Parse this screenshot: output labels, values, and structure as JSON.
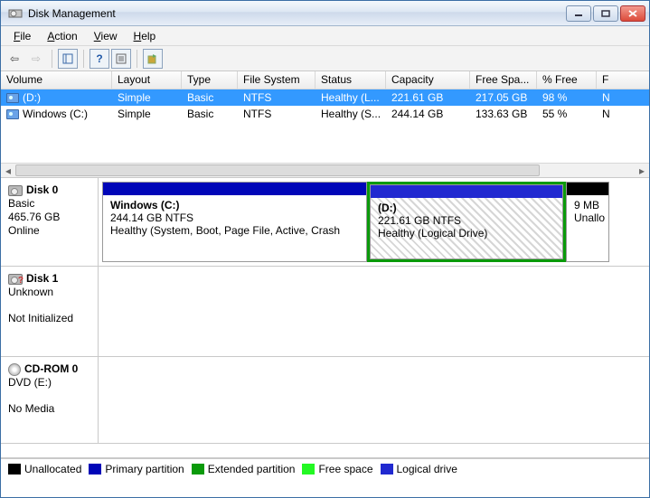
{
  "window": {
    "title": "Disk Management"
  },
  "menus": {
    "file": "File",
    "action": "Action",
    "view": "View",
    "help": "Help"
  },
  "columns": {
    "volume": "Volume",
    "layout": "Layout",
    "type": "Type",
    "filesystem": "File System",
    "status": "Status",
    "capacity": "Capacity",
    "freespace": "Free Spa...",
    "pctfree": "% Free",
    "f": "F"
  },
  "volumes": [
    {
      "name": "(D:)",
      "layout": "Simple",
      "type": "Basic",
      "fs": "NTFS",
      "status": "Healthy (L...",
      "capacity": "221.61 GB",
      "free": "217.05 GB",
      "pct": "98 %",
      "fa": "N",
      "selected": true
    },
    {
      "name": "Windows (C:)",
      "layout": "Simple",
      "type": "Basic",
      "fs": "NTFS",
      "status": "Healthy (S...",
      "capacity": "244.14 GB",
      "free": "133.63 GB",
      "pct": "55 %",
      "fa": "N",
      "selected": false
    }
  ],
  "disks": [
    {
      "id": "disk0",
      "name": "Disk 0",
      "type": "Basic",
      "size": "465.76 GB",
      "state": "Online",
      "iconKind": "hd",
      "partitions": [
        {
          "kind": "primary",
          "title": "Windows  (C:)",
          "line2": "244.14 GB NTFS",
          "line3": "Healthy (System, Boot, Page File, Active, Crash",
          "widthPx": 293,
          "hatched": false,
          "selected": false
        },
        {
          "kind": "extended",
          "children": [
            {
              "kind": "logical",
              "title": " (D:)",
              "line2": "221.61 GB NTFS",
              "line3": "Healthy (Logical Drive)",
              "widthPx": 214,
              "hatched": true,
              "selected": true
            }
          ]
        },
        {
          "kind": "unalloc",
          "title": "",
          "line2": "9 MB",
          "line3": "Unallo",
          "widthPx": 48,
          "hatched": false,
          "selected": false
        }
      ]
    },
    {
      "id": "disk1",
      "name": "Disk 1",
      "type": "Unknown",
      "size": "",
      "state": "Not Initialized",
      "iconKind": "unk",
      "partitions": []
    },
    {
      "id": "cdrom0",
      "name": "CD-ROM 0",
      "type": "DVD (E:)",
      "size": "",
      "state": "No Media",
      "iconKind": "cd",
      "partitions": []
    }
  ],
  "legend": {
    "unallocated": "Unallocated",
    "primary": "Primary partition",
    "extended": "Extended partition",
    "free": "Free space",
    "logical": "Logical drive"
  },
  "colors": {
    "unallocated": "#000000",
    "primary": "#0006b8",
    "extended": "#0a9a0a",
    "free": "#23f823",
    "logical": "#2129d0"
  }
}
